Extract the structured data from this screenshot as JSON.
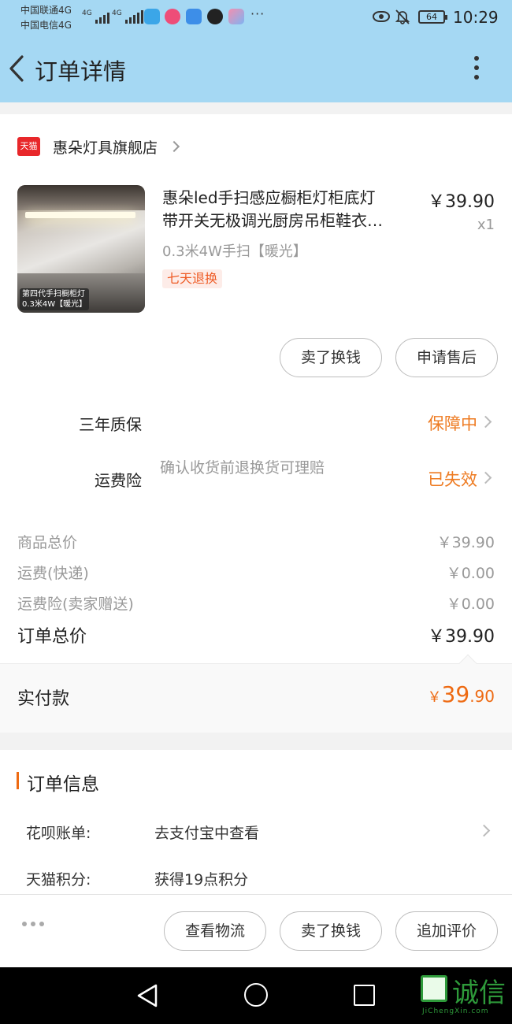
{
  "status_bar": {
    "carrier1": "中国联通4G",
    "carrier2": "中国电信4G",
    "more_dots": "···",
    "battery": "64",
    "time": "10:29"
  },
  "nav": {
    "title": "订单详情"
  },
  "shop": {
    "badge": "天猫",
    "name": "惠朵灯具旗舰店"
  },
  "product": {
    "title_line1": "惠朵led手扫感应橱柜灯柜底灯",
    "title_line2": "带开关无极调光厨房吊柜鞋衣…",
    "price": "￥39.90",
    "qty": "x1",
    "sku": "0.3米4W手扫【暖光】",
    "badge": "七天退换",
    "image_caption_line1": "第四代手扫橱柜灯",
    "image_caption_line2": "0.3米4W【暖光】"
  },
  "item_buttons": {
    "sell": "卖了换钱",
    "after_sale": "申请售后"
  },
  "services": [
    {
      "label": "三年质保",
      "status": "保障中",
      "desc": ""
    },
    {
      "label": "运费险",
      "status": "已失效",
      "desc": "确认收货前退换货可理赔"
    }
  ],
  "fees": [
    {
      "label": "商品总价",
      "value": "￥39.90"
    },
    {
      "label": "运费(快递)",
      "value": "￥0.00"
    },
    {
      "label": "运费险(卖家赠送)",
      "value": "￥0.00"
    }
  ],
  "total": {
    "label": "订单总价",
    "value": "￥39.90"
  },
  "paid": {
    "label": "实付款",
    "currency": "￥",
    "integer": "39",
    "decimal": ".90"
  },
  "order_info": {
    "title": "订单信息",
    "rows": [
      {
        "label": "花呗账单:",
        "value": "去支付宝中查看"
      },
      {
        "label": "天猫积分:",
        "value": "获得19点积分"
      }
    ]
  },
  "actions": {
    "logistics": "查看物流",
    "sell": "卖了换钱",
    "review": "追加评价"
  },
  "watermark": {
    "text": "诚信",
    "sub": "JiChengXin.com"
  },
  "colors": {
    "header_bg": "#a5d8f3",
    "accent_orange": "#ee6a12",
    "tmall_red": "#e8272a"
  }
}
